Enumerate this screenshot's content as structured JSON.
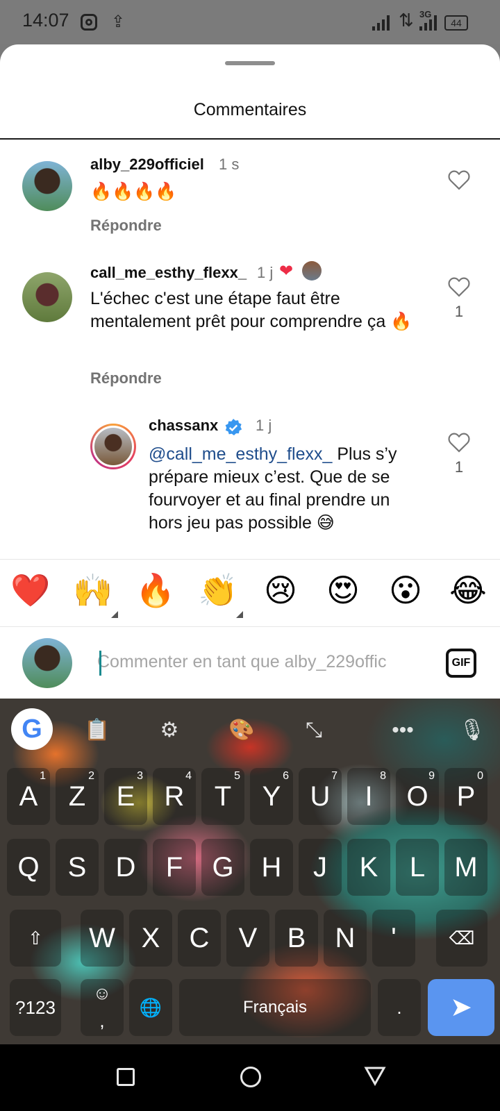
{
  "status_bar": {
    "time": "14:07",
    "network": "3G",
    "battery": "44"
  },
  "sheet": {
    "title": "Commentaires"
  },
  "comments": [
    {
      "username": "alby_229officiel",
      "time": "1 s",
      "text": "🔥🔥🔥🔥",
      "reply_label": "Répondre"
    },
    {
      "username": "call_me_esthy_flexx_",
      "time": "1 j",
      "text": "L'échec c'est une étape faut être mentalement prêt pour comprendre ça 🔥",
      "reply_label": "Répondre",
      "likes": "1"
    },
    {
      "username": "chassanx",
      "time": "1 j",
      "mention": "@call_me_esthy_flexx_",
      "text": " Plus s’y prépare mieux c’est. Que de se fourvoyer et au final prendre un hors jeu pas possible 😅",
      "likes": "1"
    }
  ],
  "emoji_bar": [
    "❤️",
    "🙌",
    "🔥",
    "👏",
    "😢",
    "😍",
    "😮",
    "😂"
  ],
  "compose": {
    "placeholder": "Commenter en tant que alby_229offic",
    "gif_label": "GIF"
  },
  "keyboard": {
    "row1": [
      {
        "k": "A",
        "n": "1"
      },
      {
        "k": "Z",
        "n": "2"
      },
      {
        "k": "E",
        "n": "3"
      },
      {
        "k": "R",
        "n": "4"
      },
      {
        "k": "T",
        "n": "5"
      },
      {
        "k": "Y",
        "n": "6"
      },
      {
        "k": "U",
        "n": "7"
      },
      {
        "k": "I",
        "n": "8"
      },
      {
        "k": "O",
        "n": "9"
      },
      {
        "k": "P",
        "n": "0"
      }
    ],
    "row2": [
      "Q",
      "S",
      "D",
      "F",
      "G",
      "H",
      "J",
      "K",
      "L",
      "M"
    ],
    "row3": [
      "W",
      "X",
      "C",
      "V",
      "B",
      "N",
      "'"
    ],
    "symbols_label": "?123",
    "comma_label": ",",
    "space_label": "Français",
    "period_label": "."
  }
}
